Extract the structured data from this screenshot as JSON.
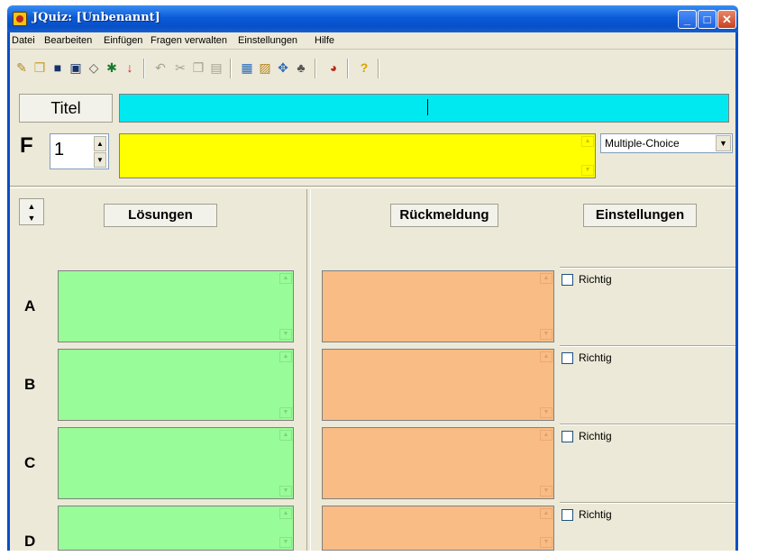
{
  "window": {
    "title": "JQuiz: [Unbenannt]"
  },
  "menu": [
    "Datei",
    "Bearbeiten",
    "Einfügen",
    "Fragen verwalten",
    "Einstellungen",
    "Hilfe"
  ],
  "toolbar": {
    "icons": [
      "new-file-icon",
      "open-folder-icon",
      "save-icon",
      "save-as-icon",
      "eraser-icon",
      "export-icon",
      "down-arrow-icon",
      "undo-icon",
      "cut-icon",
      "copy-icon",
      "paste-icon",
      "web-page-icon",
      "export-page-icon",
      "drag-drop-icon",
      "hot-potatoes-icon",
      "palette-icon",
      "help-icon"
    ]
  },
  "header": {
    "title_button": "Titel",
    "title_value": "",
    "question_label": "F",
    "question_number": "1",
    "question_text": "",
    "question_type": "Multiple-Choice"
  },
  "columns": {
    "solutions": "Lösungen",
    "feedback": "Rückmeldung",
    "settings": "Einstellungen"
  },
  "answers": [
    {
      "letter": "A",
      "correct_label": "Richtig",
      "correct": false
    },
    {
      "letter": "B",
      "correct_label": "Richtig",
      "correct": false
    },
    {
      "letter": "C",
      "correct_label": "Richtig",
      "correct": false
    },
    {
      "letter": "D",
      "correct_label": "Richtig",
      "correct": false
    }
  ],
  "colors": {
    "title_field": "#00e8f0",
    "question_field": "#ffff00",
    "solution_field": "#98fc98",
    "feedback_field": "#f8bc84"
  }
}
